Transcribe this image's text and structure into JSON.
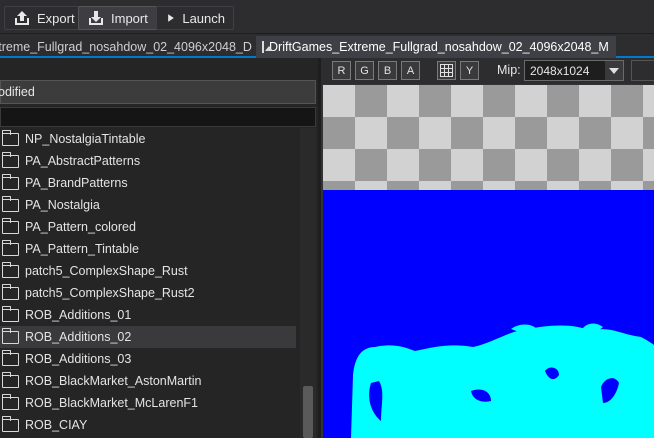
{
  "toolbar": {
    "export_label": "Export",
    "import_label": "Import",
    "launch_label": "Launch"
  },
  "tabs": [
    {
      "label": "xtreme_Fullgrad_nosahdow_02_4096x2048_D",
      "close": "✕"
    },
    {
      "label": "DriftGames_Extreme_Fullgrad_nosahdow_02_4096x2048_M",
      "close": "✕"
    }
  ],
  "left_pane": {
    "column_header": "odified",
    "items": [
      {
        "label": "NP_NostalgiaTintable"
      },
      {
        "label": "PA_AbstractPatterns"
      },
      {
        "label": "PA_BrandPatterns"
      },
      {
        "label": "PA_Nostalgia"
      },
      {
        "label": "PA_Pattern_colored"
      },
      {
        "label": "PA_Pattern_Tintable"
      },
      {
        "label": "patch5_ComplexShape_Rust"
      },
      {
        "label": "patch5_ComplexShape_Rust2"
      },
      {
        "label": "ROB_Additions_01"
      },
      {
        "label": "ROB_Additions_02"
      },
      {
        "label": "ROB_Additions_03"
      },
      {
        "label": "ROB_BlackMarket_AstonMartin"
      },
      {
        "label": "ROB_BlackMarket_McLarenF1"
      },
      {
        "label": "ROB_CIAY"
      }
    ],
    "selected_index": 9
  },
  "viewer": {
    "channels": [
      "R",
      "G",
      "B",
      "A"
    ],
    "y_label": "Y",
    "mip_label": "Mip:",
    "mip_value": "2048x1024",
    "colors": {
      "background": "#0000ff",
      "shape": "#00ffff"
    }
  }
}
